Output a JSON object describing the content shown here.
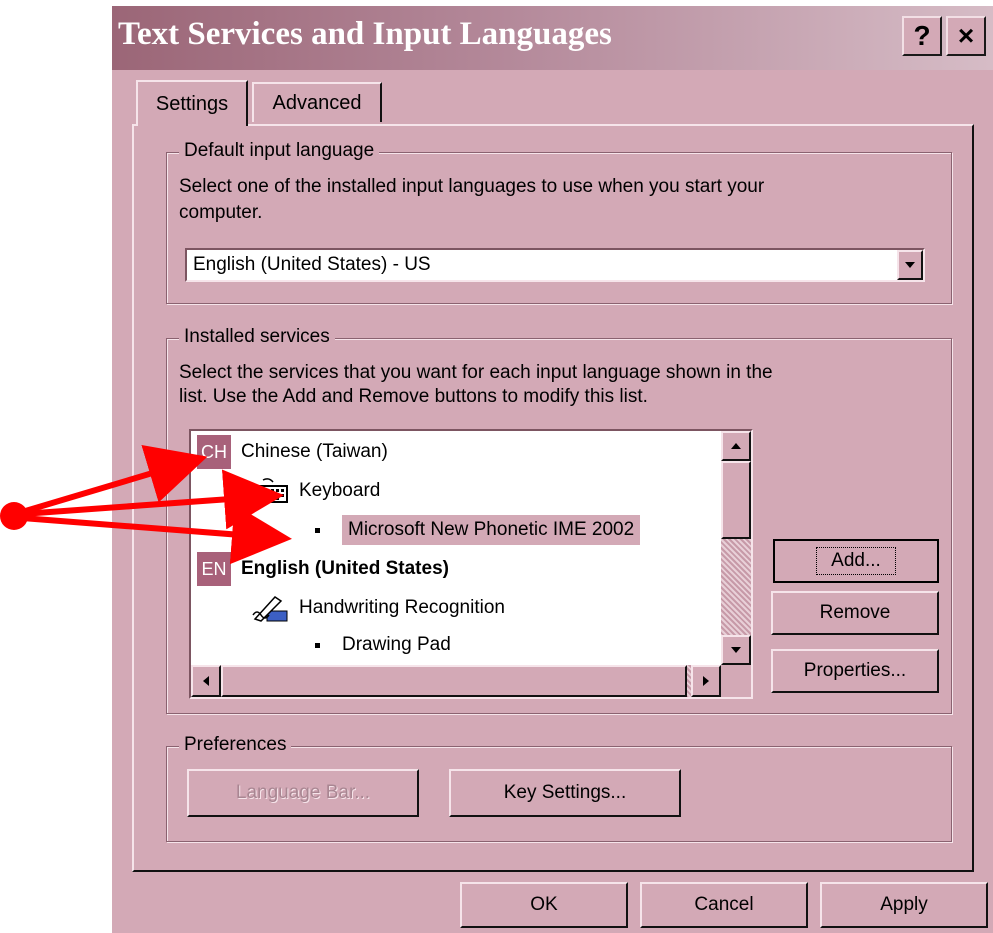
{
  "window": {
    "title": "Text Services and Input Languages",
    "help_button": "?",
    "close_button": "×"
  },
  "tabs": [
    {
      "label": "Settings",
      "selected": true
    },
    {
      "label": "Advanced",
      "selected": false
    }
  ],
  "default_input": {
    "group_label": "Default input language",
    "description_line1": "Select one of the installed input languages to use when you start your",
    "description_line2": "computer.",
    "selected_value": "English (United States) - US"
  },
  "installed_services": {
    "group_label": "Installed services",
    "description_line1": "Select the services that you want for each input language shown in the",
    "description_line2": "list. Use the Add and Remove buttons to modify this list.",
    "items": [
      {
        "badge": "CH",
        "label": "Chinese (Taiwan)",
        "level": 0
      },
      {
        "label": "Keyboard",
        "icon": "keyboard-icon",
        "level": 1
      },
      {
        "label": "Microsoft New Phonetic IME 2002",
        "level": 2,
        "selected": true
      },
      {
        "badge": "EN",
        "label": "English (United States)",
        "level": 0,
        "bold": true
      },
      {
        "label": "Handwriting Recognition",
        "icon": "handwriting-icon",
        "level": 1
      },
      {
        "label": "Drawing Pad",
        "level": 2
      }
    ],
    "buttons": {
      "add": "Add...",
      "remove": "Remove",
      "properties": "Properties..."
    }
  },
  "preferences": {
    "group_label": "Preferences",
    "language_bar": "Language Bar...",
    "key_settings": "Key Settings..."
  },
  "footer": {
    "ok": "OK",
    "cancel": "Cancel",
    "apply": "Apply"
  },
  "colors": {
    "dialog_face": "#d3a9b6",
    "badge": "#a8617a",
    "arrow": "#ff0000"
  }
}
